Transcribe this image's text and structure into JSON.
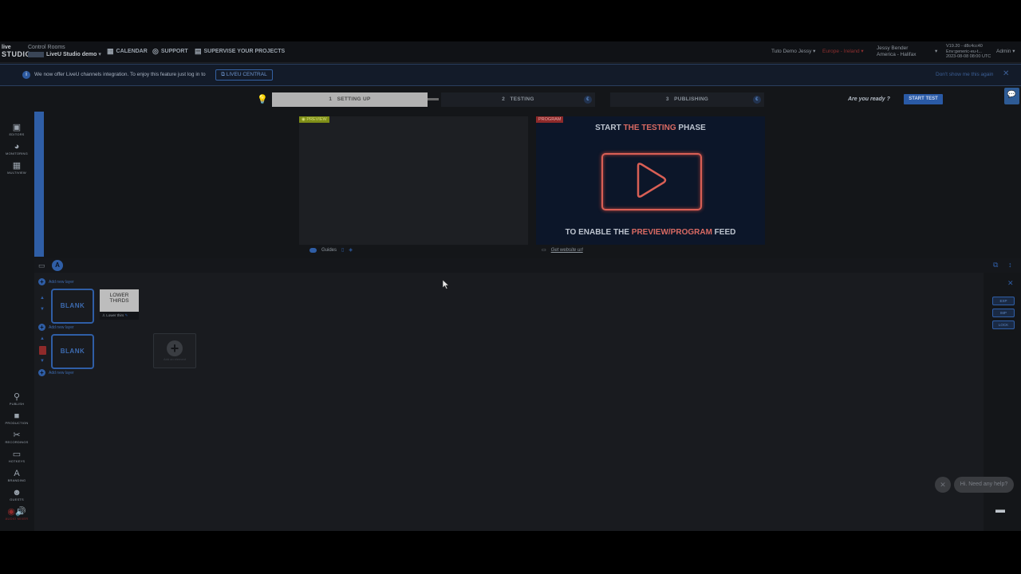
{
  "topbar": {
    "logo_line1": "live",
    "logo_line2": "STUDIO",
    "control_rooms": "Control Rooms",
    "studio_name": "LiveU Studio demo",
    "nav": [
      {
        "label": "CALENDAR",
        "icon": "calendar-icon"
      },
      {
        "label": "SUPPORT",
        "icon": "support-icon"
      },
      {
        "label": "SUPERVISE YOUR PROJECTS",
        "icon": "supervise-icon"
      }
    ],
    "org": "Tuto Demo Jessy",
    "region": "Europe - Ireland",
    "user_name": "Jessy Bender",
    "user_tz": "America - Halifax",
    "version": "V19.20 - d8c4cc40",
    "version_sub": "Env:generic-eu-t...",
    "version_date": "2023-08-08 08:00 UTC",
    "role": "Admin"
  },
  "banner": {
    "text": "We now offer LiveU channels integration. To enjoy this feature just log in to",
    "button": "LIVEU CENTRAL",
    "dont_show": "Don't show me this again",
    "close": "✕"
  },
  "steps": [
    {
      "num": "1",
      "label": "SETTING UP"
    },
    {
      "num": "2",
      "label": "TESTING"
    },
    {
      "num": "3",
      "label": "PUBLISHING"
    }
  ],
  "ready_text": "Are you ready ?",
  "start_test": "START TEST",
  "left_nav": [
    {
      "label": "EDITORS",
      "icon": "editors-icon"
    },
    {
      "label": "MONITORING",
      "icon": "monitoring-icon"
    },
    {
      "label": "MULTIVIEW",
      "icon": "multiview-icon"
    }
  ],
  "left_nav_bottom": [
    {
      "label": "PUBLISH",
      "icon": "publish-icon"
    },
    {
      "label": "PRODUCTION",
      "icon": "production-icon"
    },
    {
      "label": "RECORDINGS",
      "icon": "recordings-icon"
    },
    {
      "label": "HOTKEYS",
      "icon": "hotkeys-icon"
    },
    {
      "label": "BRANDING",
      "icon": "branding-icon"
    },
    {
      "label": "GUESTS",
      "icon": "guests-icon"
    },
    {
      "label": "AUDIO MIXER",
      "icon": "audio-mixer-icon"
    }
  ],
  "preview": {
    "tag": "PREVIEW",
    "guides": "Guides"
  },
  "program": {
    "tag": "PROGRAM",
    "top_a": "START ",
    "top_b": "THE TESTING",
    "top_c": " PHASE",
    "bot_a": "TO ENABLE THE ",
    "bot_b": "PREVIEW/PROGRAM",
    "bot_c": " FEED",
    "embed": "Get website url"
  },
  "layers": {
    "add_layer": "Add new layer",
    "blank": "BLANK",
    "lower_thirds_line1": "LOWER",
    "lower_thirds_line2": "THIRDS",
    "lower_thirds_caption": "Lower thirs",
    "add_slot": "Add an element"
  },
  "right_col": [
    {
      "label": "EXP"
    },
    {
      "label": "IMP"
    },
    {
      "label": "LOCK"
    }
  ],
  "help": {
    "text": "Hi. Need any help?",
    "close": "✕"
  },
  "colors": {
    "accent": "#2f5ea6",
    "program": "#8e2a2a",
    "preview": "#7f8e18"
  }
}
